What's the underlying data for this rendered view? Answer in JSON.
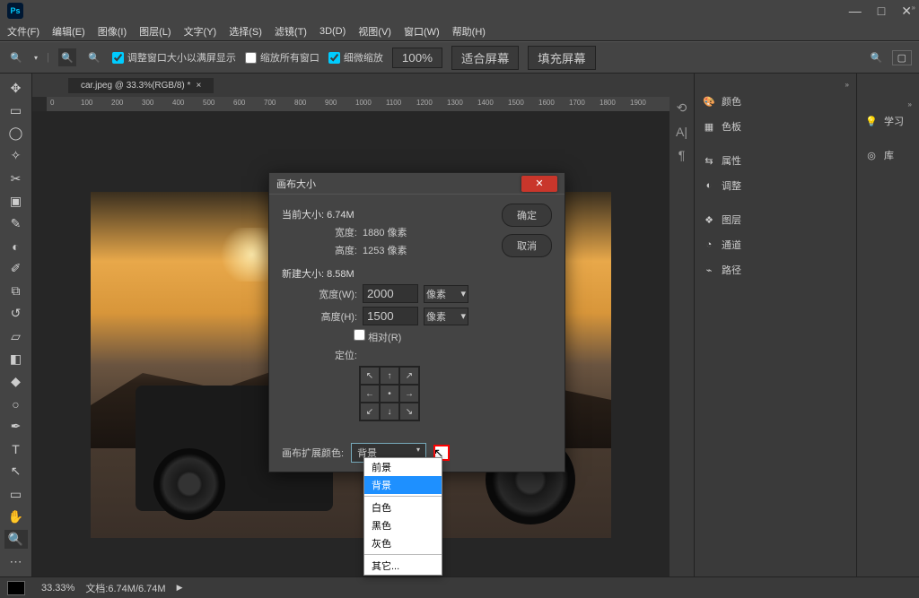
{
  "app": {
    "logo_text": "Ps"
  },
  "menu": {
    "file": "文件(F)",
    "edit": "编辑(E)",
    "image": "图像(I)",
    "layer": "图层(L)",
    "type": "文字(Y)",
    "select": "选择(S)",
    "filter": "滤镜(T)",
    "threed": "3D(D)",
    "view": "视图(V)",
    "window": "窗口(W)",
    "help": "帮助(H)"
  },
  "options": {
    "resize_chk": "调整窗口大小以满屏显示",
    "zoom_all_chk": "缩放所有窗口",
    "scrubby_chk": "细微缩放",
    "hundred": "100%",
    "fit": "适合屏幕",
    "fill": "填充屏幕"
  },
  "tab": {
    "label": "car.jpeg @ 33.3%(RGB/8) *"
  },
  "ruler": [
    "0",
    "100",
    "200",
    "300",
    "400",
    "500",
    "600",
    "700",
    "800",
    "900",
    "1000",
    "1100",
    "1200",
    "1300",
    "1400",
    "1500",
    "1600",
    "1700",
    "1800",
    "1900"
  ],
  "panels": {
    "color": "颜色",
    "swatches": "色板",
    "properties": "属性",
    "adjustments": "调整",
    "layers": "图层",
    "channels": "通道",
    "paths": "路径",
    "learn": "学习",
    "library": "库"
  },
  "status": {
    "zoom": "33.33%",
    "doc": "文档:6.74M/6.74M"
  },
  "dialog": {
    "title": "画布大小",
    "ok": "确定",
    "cancel": "取消",
    "cur_label": "当前大小:",
    "cur_size": "6.74M",
    "cur_w_label": "宽度:",
    "cur_w": "1880 像素",
    "cur_h_label": "高度:",
    "cur_h": "1253 像素",
    "new_label": "新建大小:",
    "new_size": "8.58M",
    "new_w_label": "宽度(W):",
    "new_w": "2000",
    "new_w_unit": "像素",
    "new_h_label": "高度(H):",
    "new_h": "1500",
    "new_h_unit": "像素",
    "relative": "相对(R)",
    "anchor": "定位:",
    "ext_label": "画布扩展颜色:",
    "ext_value": "背景"
  },
  "dropdown": {
    "foreground": "前景",
    "background": "背景",
    "white": "白色",
    "black": "黑色",
    "gray": "灰色",
    "other": "其它..."
  }
}
